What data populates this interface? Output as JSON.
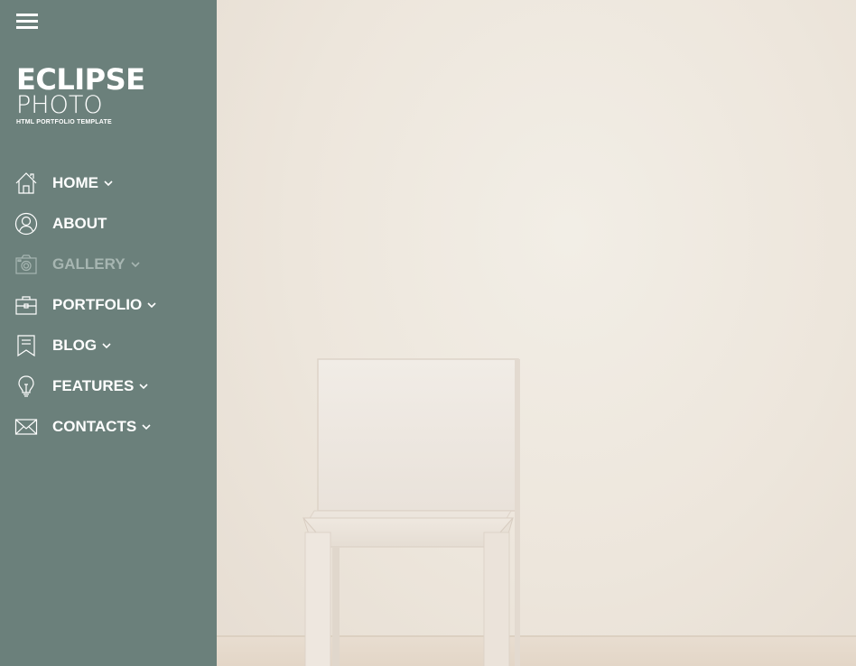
{
  "menu": {
    "hamburger_icon": "hamburger-menu-icon"
  },
  "logo": {
    "main": "ECLIPSE",
    "sub": "PHOTO",
    "tagline": "HTML PORTFOLIO TEMPLATE"
  },
  "nav": {
    "items": [
      {
        "label": "HOME",
        "icon": "home-icon",
        "has_dropdown": true
      },
      {
        "label": "ABOUT",
        "icon": "user-icon",
        "has_dropdown": false
      },
      {
        "label": "GALLERY",
        "icon": "camera-icon",
        "has_dropdown": true,
        "active": true
      },
      {
        "label": "PORTFOLIO",
        "icon": "briefcase-icon",
        "has_dropdown": true
      },
      {
        "label": "BLOG",
        "icon": "bookmark-icon",
        "has_dropdown": true
      },
      {
        "label": "FEATURES",
        "icon": "lightbulb-icon",
        "has_dropdown": true
      },
      {
        "label": "CONTACTS",
        "icon": "envelope-icon",
        "has_dropdown": true
      }
    ]
  },
  "colors": {
    "sidebar_bg": "#6b807b",
    "nav_text": "#ffffff",
    "nav_muted": "#a7b6b2",
    "hero_wall": "#ede6dc"
  }
}
